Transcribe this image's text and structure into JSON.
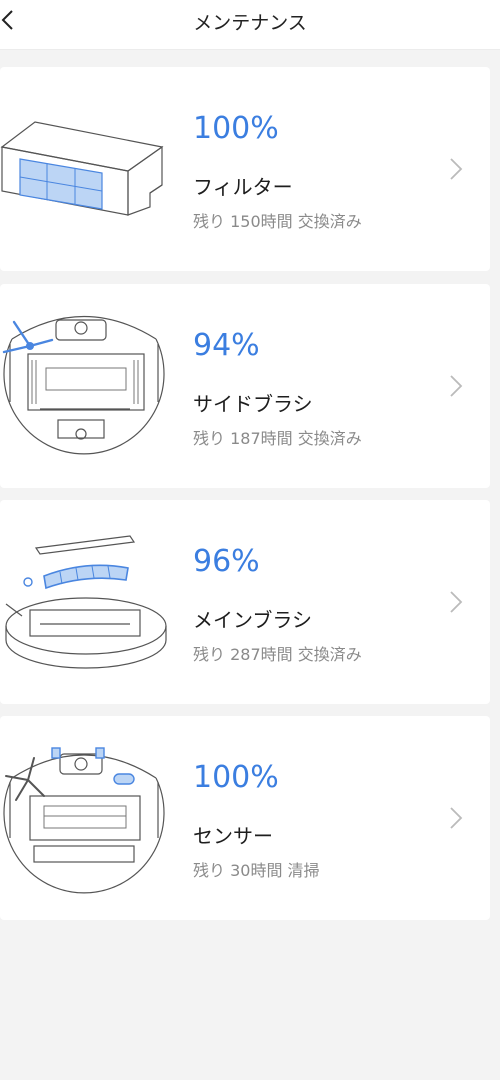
{
  "header": {
    "title": "メンテナンス",
    "back_icon": "chevron-left-icon"
  },
  "accent_color": "#3b7ee0",
  "items": [
    {
      "percent": "100%",
      "level": 1.0,
      "name": "フィルター",
      "remaining": "残り 150時間 交換済み",
      "icon": "filter-icon"
    },
    {
      "percent": "94%",
      "level": 0.94,
      "name": "サイドブラシ",
      "remaining": "残り 187時間 交換済み",
      "icon": "side-brush-icon"
    },
    {
      "percent": "96%",
      "level": 0.96,
      "name": "メインブラシ",
      "remaining": "残り 287時間 交換済み",
      "icon": "main-brush-icon"
    },
    {
      "percent": "100%",
      "level": 1.0,
      "name": "センサー",
      "remaining": "残り 30時間 清掃",
      "icon": "sensor-icon"
    }
  ]
}
